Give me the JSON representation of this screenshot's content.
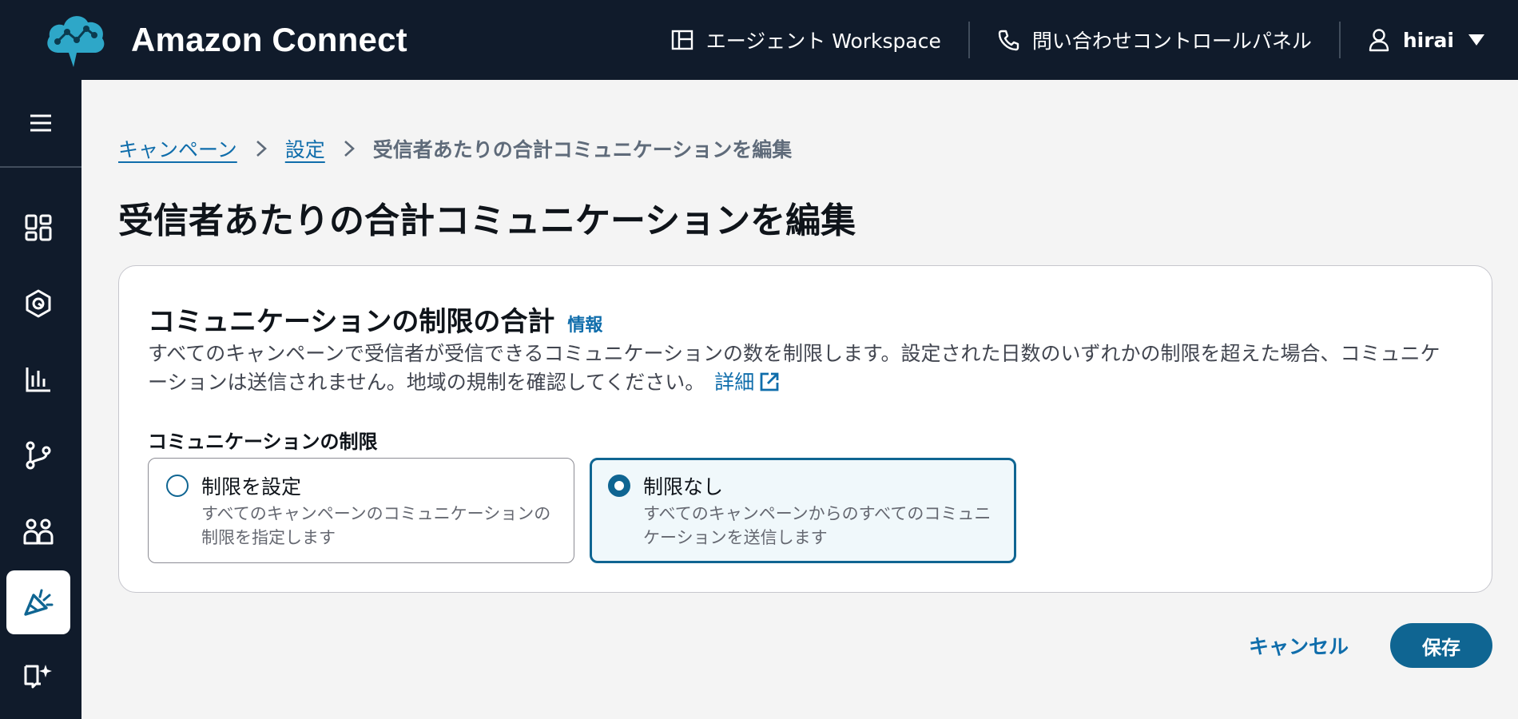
{
  "header": {
    "brand_name": "Amazon Connect",
    "agent_workspace_label": "エージェント Workspace",
    "contact_control_panel_label": "問い合わせコントロールパネル",
    "user_name": "hirai"
  },
  "sidebar": {
    "items": [
      {
        "icon": "dashboard-icon"
      },
      {
        "icon": "routing-icon"
      },
      {
        "icon": "analytics-icon"
      },
      {
        "icon": "flows-icon"
      },
      {
        "icon": "users-icon"
      },
      {
        "icon": "campaigns-icon",
        "active": true
      },
      {
        "icon": "knowledge-icon"
      }
    ]
  },
  "breadcrumb": {
    "items": [
      "キャンペーン",
      "設定"
    ],
    "current": "受信者あたりの合計コミュニケーションを編集"
  },
  "page": {
    "title": "受信者あたりの合計コミュニケーションを編集"
  },
  "panel": {
    "title": "コミュニケーションの制限の合計",
    "info_label": "情報",
    "description": "すべてのキャンペーンで受信者が受信できるコミュニケーションの数を制限します。設定された日数のいずれかの制限を超えた場合、コミュニケーションは送信されません。地域の規制を確認してください。",
    "detail_link": "詳細",
    "field_label": "コミュニケーションの制限",
    "options": [
      {
        "title": "制限を設定",
        "description": "すべてのキャンペーンのコミュニケーションの制限を指定します",
        "selected": false
      },
      {
        "title": "制限なし",
        "description": "すべてのキャンペーンからのすべてのコミュニケーションを送信します",
        "selected": true
      }
    ]
  },
  "actions": {
    "cancel_label": "キャンセル",
    "save_label": "保存"
  },
  "colors": {
    "header_bg": "#101b2b",
    "primary": "#0f6592",
    "link": "#0f6dab",
    "logo": "#2ea7c8"
  }
}
